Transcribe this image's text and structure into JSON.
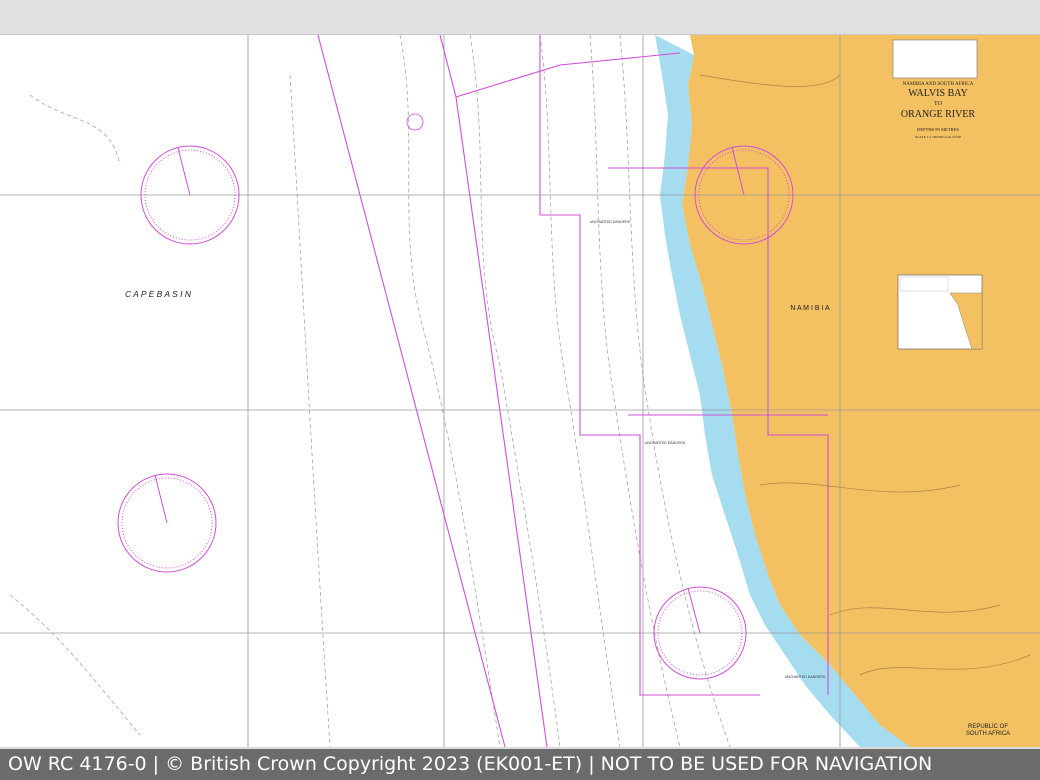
{
  "chart": {
    "region_heading": "NAMIBIA AND SOUTH AFRICA",
    "title_line1": "WALVIS BAY",
    "title_to": "TO",
    "title_line2": "ORANGE RIVER",
    "depths_note": "DEPTHS IN METRES",
    "scale_note": "SCALE 1:1 500 000 at lat 23°00'",
    "basin_label": "C A P E   B A S I N",
    "country_label": "N A M I B I A",
    "country_label_south_1": "REPUBLIC OF",
    "country_label_south_2": "SOUTH AFRICA",
    "uncharted_label": "UNCHARTED DANGERS"
  },
  "colors": {
    "land": "#f3c062",
    "shallow_water": "#a5dcef",
    "deep_water": "#ffffff",
    "magenta": "#d04fd8",
    "grid": "#9a9a9a"
  },
  "footer": {
    "text": "OW RC 4176-0 | © British Crown Copyright 2023 (EK001-ET) | NOT TO BE USED FOR NAVIGATION"
  }
}
